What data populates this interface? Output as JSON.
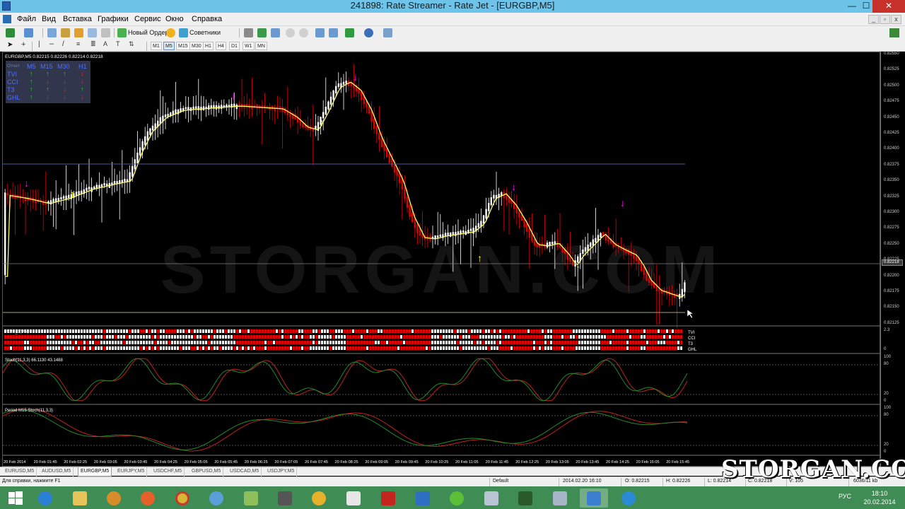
{
  "window": {
    "title": "241898: Rate Streamer - Rate Jet - [EURGBP,M5]",
    "minimize": "—",
    "maximize": "☐",
    "close": "✕"
  },
  "menu": {
    "items": [
      "Файл",
      "Вид",
      "Вставка",
      "Графики",
      "Сервис",
      "Окно",
      "Справка"
    ]
  },
  "toolbar": {
    "new_order": "Новый Ордер",
    "experts": "Советники",
    "timeframes": [
      "M1",
      "M5",
      "M15",
      "M30",
      "H1",
      "H4",
      "D1",
      "W1",
      "MN"
    ]
  },
  "chart": {
    "header": "EURGBP,M5  0.82215 0.82226 0.82214 0.82218",
    "watermark": "STORGAN.COM",
    "current_price": "0.82218",
    "price_ticks": [
      "0.82550",
      "0.82525",
      "0.82500",
      "0.82475",
      "0.82450",
      "0.82425",
      "0.82400",
      "0.82375",
      "0.82350",
      "0.82325",
      "0.82300",
      "0.82275",
      "0.82250",
      "0.82225",
      "0.82200",
      "0.82175",
      "0.82150",
      "0.82125"
    ],
    "dashboard": {
      "title": "Отчет",
      "timeframes": [
        "M5",
        "M15",
        "M30",
        "H1"
      ],
      "rows": [
        {
          "name": "TVI",
          "signals": [
            "up",
            "up",
            "up",
            "down"
          ]
        },
        {
          "name": "CCI",
          "signals": [
            "up",
            "down",
            "down",
            "down"
          ]
        },
        {
          "name": "T3",
          "signals": [
            "up",
            "up",
            "down",
            "up"
          ]
        },
        {
          "name": "GHL",
          "signals": [
            "up",
            "down",
            "down",
            "down"
          ]
        }
      ]
    },
    "subwindow_signal": {
      "label": "#021_3(M5)",
      "row_labels": [
        "TVI",
        "CCI",
        "T3",
        "GHL"
      ],
      "scale": [
        "2.3",
        "0"
      ]
    },
    "subwindow_stoch": {
      "label": "Stoch(11,3,3) 66.1130 43.1488",
      "scale": [
        "100",
        "80",
        "20",
        "0"
      ]
    },
    "subwindow_m15": {
      "label": "Period M15 Stoch(11,3,3)",
      "scale": [
        "100",
        "80",
        "20",
        "0"
      ]
    },
    "time_labels": [
      "20 Feb 2014",
      "20 Feb 01:45",
      "20 Feb 02:25",
      "20 Feb 03:05",
      "20 Feb 03:45",
      "20 Feb 04:25",
      "20 Feb 05:05",
      "20 Feb 05:45",
      "20 Feb 06:25",
      "20 Feb 07:05",
      "20 Feb 07:45",
      "20 Feb 08:25",
      "20 Feb 09:05",
      "20 Feb 09:45",
      "20 Feb 10:25",
      "20 Feb 11:05",
      "20 Feb 11:45",
      "20 Feb 12:25",
      "20 Feb 13:05",
      "20 Feb 13:45",
      "20 Feb 14:25",
      "20 Feb 15:05",
      "20 Feb 15:45"
    ]
  },
  "tabs": [
    "EURUSD,M5",
    "AUDUSD,M5",
    "EURGBP,M5",
    "EURJPY,M5",
    "USDCHF,M5",
    "GBPUSD,M5",
    "USDCAD,M5",
    "USDJPY,M5"
  ],
  "active_tab": "EURGBP,M5",
  "status": {
    "help": "Для справки, нажмите F1",
    "profile": "Default",
    "datetime": "2014.02.20 16:10",
    "open": "O: 0.82215",
    "high": "H: 0.82226",
    "low": "L: 0.82214",
    "close": "C: 0.82218",
    "volume": "V: 105",
    "traffic": "6036/11 kb"
  },
  "watermark_corner": "STORGAN.COM",
  "taskbar": {
    "lang": "РУС",
    "time": "18:10",
    "date": "20.02.2014"
  },
  "colors": {
    "bull": "#ffffff",
    "bear": "#e00000",
    "ma": "#ffff66",
    "arrow_up": "#ffff00",
    "arrow_down": "#ff00ff",
    "titlebar": "#6ec3e8",
    "taskbar": "#3f8c55"
  }
}
